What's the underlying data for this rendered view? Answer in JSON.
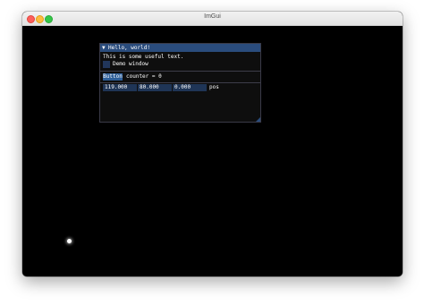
{
  "window": {
    "title": "ImGui"
  },
  "imgui_window": {
    "title": "Hello, world!",
    "collapse_arrow": "▼",
    "text": "This is some useful text.",
    "checkbox_label": "Demo window",
    "button_label": "Button",
    "counter_text": "counter = 0",
    "fields": [
      "119.000",
      "80.000",
      "0.000"
    ],
    "fields_label": "pos"
  },
  "colors": {
    "imgui_title_bar": "#2a4c7d",
    "imgui_button": "#2e5f99",
    "imgui_frame": "#1f3556",
    "background": "#000000"
  },
  "icons": [
    "collapse-arrow-icon",
    "resize-grip-icon",
    "mouse-cursor-icon"
  ]
}
